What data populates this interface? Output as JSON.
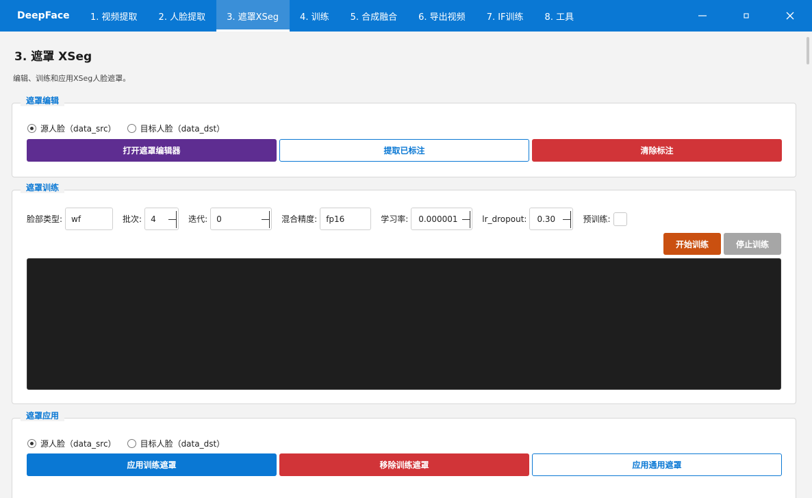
{
  "app": {
    "title": "DeepFace",
    "tabs": [
      {
        "label": "1. 视频提取",
        "active": false
      },
      {
        "label": "2. 人脸提取",
        "active": false
      },
      {
        "label": "3. 遮罩XSeg",
        "active": true
      },
      {
        "label": "4. 训练",
        "active": false
      },
      {
        "label": "5. 合成融合",
        "active": false
      },
      {
        "label": "6. 导出视频",
        "active": false
      },
      {
        "label": "7. IF训练",
        "active": false
      },
      {
        "label": "8. 工具",
        "active": false
      }
    ],
    "window_controls": {
      "minimize": "minimize-icon",
      "maximize": "maximize-icon",
      "close": "close-icon"
    },
    "accent_color": "#0a78d4"
  },
  "page": {
    "title": "3. 遮罩 XSeg",
    "description": "编辑、训练和应用XSeg人脸遮罩。"
  },
  "mask_edit": {
    "title": "遮罩编辑",
    "radio_src": "源人脸（data_src）",
    "radio_dst": "目标人脸（data_dst）",
    "selected": "src",
    "btn_open_editor": "打开遮罩编辑器",
    "btn_extract_labeled": "提取已标注",
    "btn_clear_labels": "清除标注"
  },
  "mask_train": {
    "title": "遮罩训练",
    "face_type_label": "脸部类型:",
    "face_type_value": "wf",
    "batch_label": "批次:",
    "batch_value": "4",
    "iter_label": "迭代:",
    "iter_value": "0",
    "precision_label": "混合精度:",
    "precision_value": "fp16",
    "lr_label": "学习率:",
    "lr_value": "0.000001",
    "lr_dropout_label": "lr_dropout:",
    "lr_dropout_value": "0.30",
    "pretrain_label": "预训练:",
    "pretrain_checked": false,
    "btn_start": "开始训练",
    "btn_stop": "停止训练",
    "console_text": ""
  },
  "mask_apply": {
    "title": "遮罩应用",
    "radio_src": "源人脸（data_src）",
    "radio_dst": "目标人脸（data_dst）",
    "selected": "src",
    "btn_apply_trained": "应用训练遮罩",
    "btn_remove_trained": "移除训练遮罩",
    "btn_apply_generic": "应用通用遮罩"
  }
}
